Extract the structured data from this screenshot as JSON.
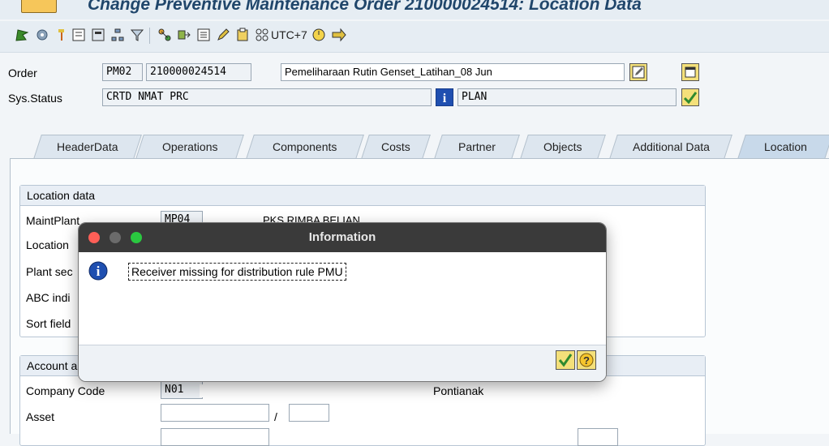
{
  "window": {
    "title": "Change Preventive Maintenance Order 210000024514: Location Data"
  },
  "toolbar": {
    "timezone_label": "UTC+7"
  },
  "header": {
    "order_label": "Order",
    "order_type": "PM02",
    "order_number": "210000024514",
    "order_description": "Pemeliharaan Rutin Genset_Latihan_08 Jun",
    "sysstatus_label": "Sys.Status",
    "sys_status": "CRTD NMAT PRC",
    "user_status": "PLAN"
  },
  "tabs": [
    {
      "label": "HeaderData"
    },
    {
      "label": "Operations"
    },
    {
      "label": "Components"
    },
    {
      "label": "Costs"
    },
    {
      "label": "Partner"
    },
    {
      "label": "Objects"
    },
    {
      "label": "Additional Data"
    },
    {
      "label": "Location"
    }
  ],
  "location_group": {
    "title": "Location data",
    "rows": [
      {
        "label": "MaintPlant",
        "value": "MP04",
        "text": "PKS RIMBA BELIAN"
      },
      {
        "label": "Location",
        "value": "",
        "text": ""
      },
      {
        "label": "Plant sec",
        "value": "",
        "text": ""
      },
      {
        "label": "ABC indi",
        "value": "",
        "text": ""
      },
      {
        "label": "Sort field",
        "value": "",
        "text": ""
      }
    ]
  },
  "account_group": {
    "title": "Account a",
    "company_code_label": "Company Code",
    "company_code": "N01",
    "company_text": "Pontianak",
    "asset_label": "Asset",
    "asset_separator": "/"
  },
  "dialog": {
    "title": "Information",
    "message": "Receiver missing for distribution rule PMU"
  },
  "colors": {
    "accent": "#20466b",
    "dialog_titlebar": "#3a3a3a",
    "ok_green": "#2f8a2f"
  }
}
